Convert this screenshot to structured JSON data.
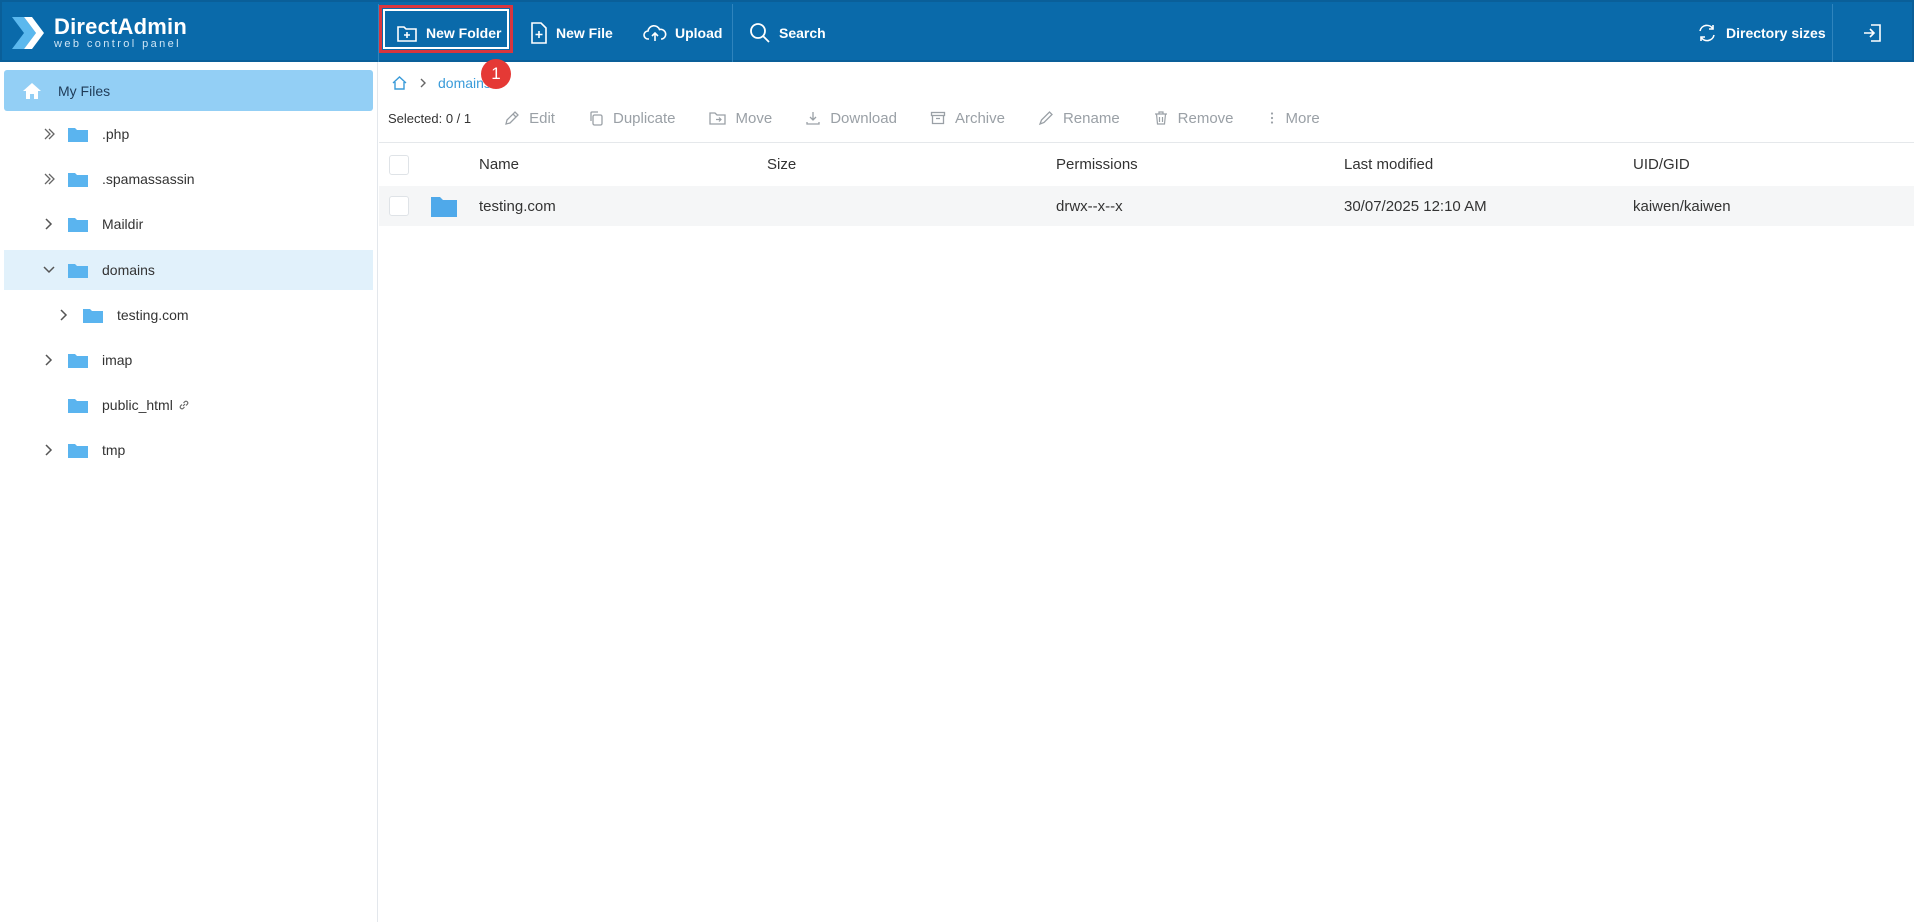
{
  "app": {
    "logo_title": "DirectAdmin",
    "logo_subtitle": "web control panel",
    "accent_color": "#0a6aaa"
  },
  "toolbar": {
    "new_folder": "New Folder",
    "new_file": "New File",
    "upload": "Upload",
    "search": "Search",
    "directory_sizes": "Directory sizes",
    "logout_icon": "logout-icon"
  },
  "annotation": {
    "badge": "1"
  },
  "sidebar": {
    "root": "My Files",
    "items": [
      {
        "label": ".php",
        "chevron": "double"
      },
      {
        "label": ".spamassassin",
        "chevron": "double"
      },
      {
        "label": "Maildir",
        "chevron": "right"
      },
      {
        "label": "domains",
        "chevron": "down",
        "selected": true
      },
      {
        "label": "testing.com",
        "chevron": "right"
      },
      {
        "label": "imap",
        "chevron": "right"
      },
      {
        "label": "public_html",
        "chevron": "none",
        "link_icon": true
      },
      {
        "label": "tmp",
        "chevron": "right"
      }
    ]
  },
  "breadcrumb": {
    "current": "domains"
  },
  "actions": {
    "selected_label": "Selected: 0 / 1",
    "edit": "Edit",
    "duplicate": "Duplicate",
    "move": "Move",
    "download": "Download",
    "archive": "Archive",
    "rename": "Rename",
    "remove": "Remove",
    "more": "More"
  },
  "table": {
    "columns": [
      "Name",
      "Size",
      "Permissions",
      "Last modified",
      "UID/GID"
    ],
    "rows": [
      {
        "name": "testing.com",
        "size": "",
        "permissions": "drwx--x--x",
        "modified": "30/07/2025 12:10 AM",
        "owner": "kaiwen/kaiwen"
      }
    ]
  }
}
